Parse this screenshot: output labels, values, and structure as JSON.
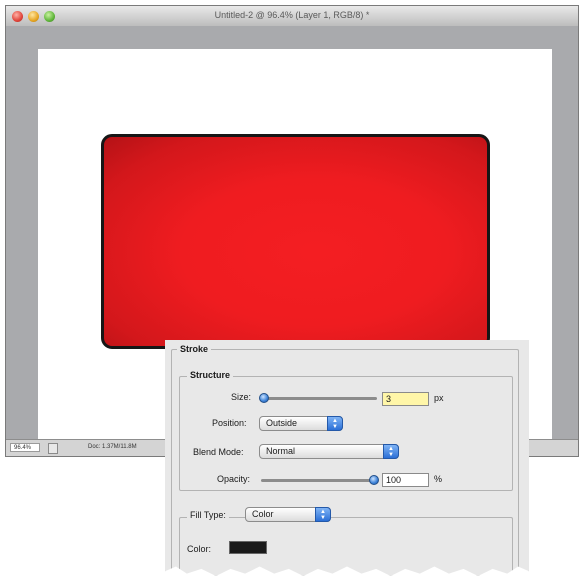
{
  "window": {
    "title": "Untitled-2 @ 96.4% (Layer 1, RGB/8) *"
  },
  "statusbar": {
    "zoom": "96.4%",
    "doc_info": "Doc: 1.37M/11.8M"
  },
  "stroke_dialog": {
    "section_title": "Stroke",
    "structure": {
      "title": "Structure",
      "size_label": "Size:",
      "size_value": "3",
      "size_unit": "px",
      "position_label": "Position:",
      "position_value": "Outside",
      "blend_mode_label": "Blend Mode:",
      "blend_mode_value": "Normal",
      "opacity_label": "Opacity:",
      "opacity_value": "100",
      "opacity_unit": "%"
    },
    "fill": {
      "fill_type_label": "Fill Type:",
      "fill_type_value": "Color",
      "color_label": "Color:",
      "color_value": "#1a1a1a"
    }
  },
  "colors": {
    "shape_fill": "#ef1c20",
    "shape_stroke": "#161616"
  }
}
